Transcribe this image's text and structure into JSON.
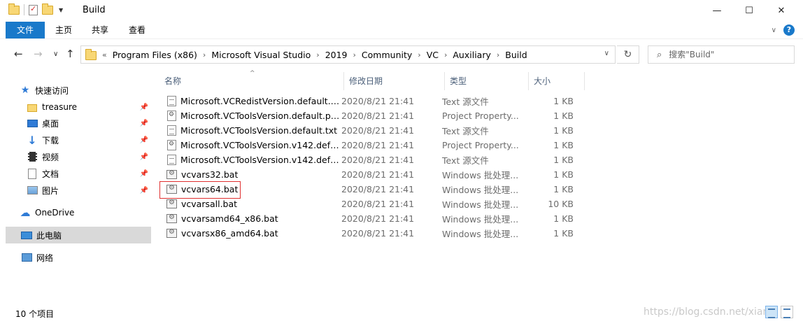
{
  "window": {
    "title": "Build",
    "controls": {
      "minimize": "—",
      "maximize": "☐",
      "close": "✕"
    }
  },
  "ribbon": {
    "tabs": [
      {
        "label": "文件"
      },
      {
        "label": "主页"
      },
      {
        "label": "共享"
      },
      {
        "label": "查看"
      }
    ],
    "help": "?"
  },
  "address": {
    "overflow": "«",
    "crumbs": [
      "Program Files (x86)",
      "Microsoft Visual Studio",
      "2019",
      "Community",
      "VC",
      "Auxiliary",
      "Build"
    ],
    "separator": "›"
  },
  "search": {
    "placeholder": "搜索\"Build\""
  },
  "sidebar": {
    "items": [
      {
        "label": "快速访问"
      },
      {
        "label": "treasure"
      },
      {
        "label": "桌面"
      },
      {
        "label": "下载"
      },
      {
        "label": "视频"
      },
      {
        "label": "文档"
      },
      {
        "label": "图片"
      },
      {
        "label": "OneDrive"
      },
      {
        "label": "此电脑"
      },
      {
        "label": "网络"
      }
    ]
  },
  "columns": {
    "name": "名称",
    "date": "修改日期",
    "type": "类型",
    "size": "大小"
  },
  "files": [
    {
      "name": "Microsoft.VCRedistVersion.default.txt",
      "date": "2020/8/21 21:41",
      "type": "Text 源文件",
      "size": "1 KB"
    },
    {
      "name": "Microsoft.VCToolsVersion.default.pr...",
      "date": "2020/8/21 21:41",
      "type": "Project Property...",
      "size": "1 KB"
    },
    {
      "name": "Microsoft.VCToolsVersion.default.txt",
      "date": "2020/8/21 21:41",
      "type": "Text 源文件",
      "size": "1 KB"
    },
    {
      "name": "Microsoft.VCToolsVersion.v142.defau...",
      "date": "2020/8/21 21:41",
      "type": "Project Property...",
      "size": "1 KB"
    },
    {
      "name": "Microsoft.VCToolsVersion.v142.defau...",
      "date": "2020/8/21 21:41",
      "type": "Text 源文件",
      "size": "1 KB"
    },
    {
      "name": "vcvars32.bat",
      "date": "2020/8/21 21:41",
      "type": "Windows 批处理...",
      "size": "1 KB"
    },
    {
      "name": "vcvars64.bat",
      "date": "2020/8/21 21:41",
      "type": "Windows 批处理...",
      "size": "1 KB"
    },
    {
      "name": "vcvarsall.bat",
      "date": "2020/8/21 21:41",
      "type": "Windows 批处理...",
      "size": "10 KB"
    },
    {
      "name": "vcvarsamd64_x86.bat",
      "date": "2020/8/21 21:41",
      "type": "Windows 批处理...",
      "size": "1 KB"
    },
    {
      "name": "vcvarsx86_amd64.bat",
      "date": "2020/8/21 21:41",
      "type": "Windows 批处理...",
      "size": "1 KB"
    }
  ],
  "status": {
    "count": "10 个项目",
    "watermark": "https://blog.csdn.net/xian"
  }
}
